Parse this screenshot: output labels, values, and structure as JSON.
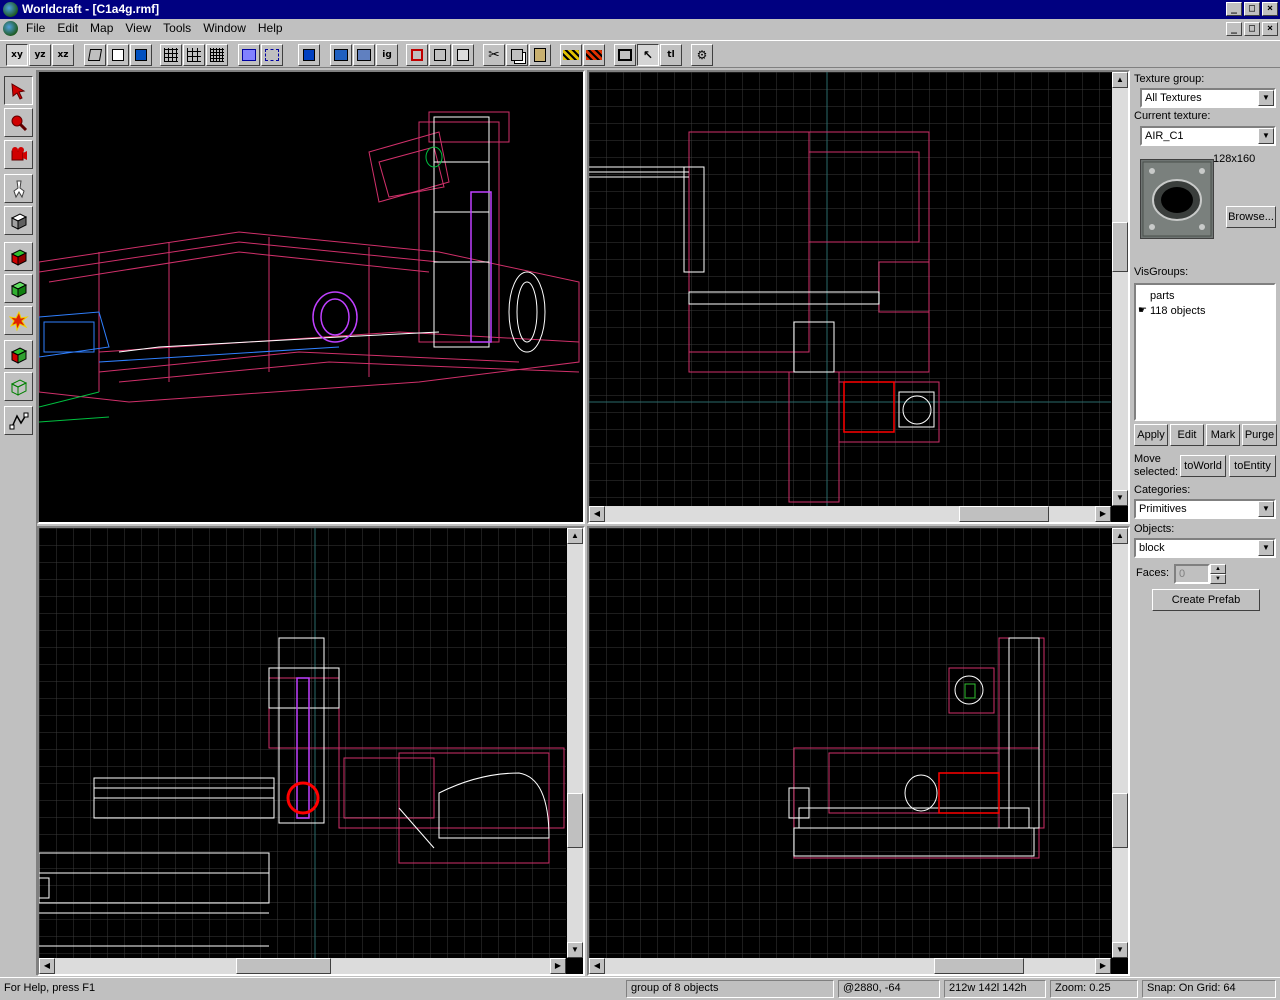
{
  "window": {
    "title": "Worldcraft - [C1a4g.rmf]",
    "controls": [
      "_",
      "□",
      "×"
    ]
  },
  "menu": {
    "items": [
      "File",
      "Edit",
      "Map",
      "View",
      "Tools",
      "Window",
      "Help"
    ]
  },
  "toolbar": {
    "view_buttons": [
      "xy",
      "yz",
      "xz"
    ],
    "ig_label": "ig",
    "tl_label": "tl"
  },
  "right_panel": {
    "texture_group_label": "Texture group:",
    "texture_group_value": "All Textures",
    "current_texture_label": "Current texture:",
    "current_texture_value": "AIR_C1",
    "texture_size": "128x160",
    "browse_button": "Browse...",
    "visgroups_label": "VisGroups:",
    "visgroups": [
      {
        "label": "parts"
      },
      {
        "label": "118 objects"
      }
    ],
    "apply_button": "Apply",
    "edit_button": "Edit",
    "mark_button": "Mark",
    "purge_button": "Purge",
    "move_selected_label_1": "Move",
    "move_selected_label_2": "selected:",
    "to_world_button": "toWorld",
    "to_entity_button": "toEntity",
    "categories_label": "Categories:",
    "categories_value": "Primitives",
    "objects_label": "Objects:",
    "objects_value": "block",
    "faces_label": "Faces:",
    "faces_value": "0",
    "create_prefab_button": "Create Prefab"
  },
  "status": {
    "help": "For Help, press F1",
    "selection": "group of 8 objects",
    "coords": "@2880, -64",
    "size": "212w 142l 142h",
    "zoom": "Zoom: 0.25",
    "snap": "Snap: On Grid: 64"
  },
  "colors": {
    "titlebar": "#000080",
    "wire_magenta": "#d0306a",
    "wire_white": "#ffffff",
    "grid": "#3a3a3a",
    "selection_red": "#ff0000"
  }
}
